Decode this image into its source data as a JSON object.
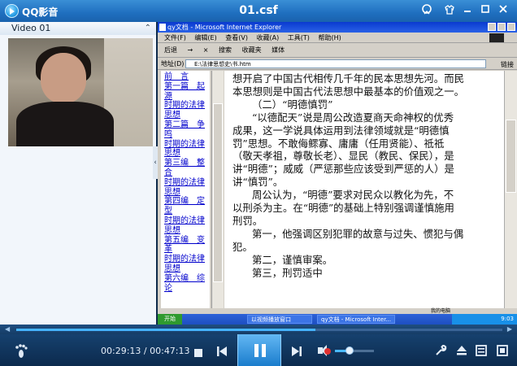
{
  "window": {
    "app_name": "QQ影音",
    "file_name": "01.csf"
  },
  "playlist": {
    "title": "Video 01",
    "collapse_glyph": "⌃"
  },
  "video_frame": {
    "ie_title": "qy文档 - Microsoft Internet Explorer",
    "ie_menu": [
      "文件(F)",
      "编辑(E)",
      "查看(V)",
      "收藏(A)",
      "工具(T)",
      "帮助(H)"
    ],
    "ie_toolbar": [
      "后退",
      "→",
      "×",
      "搜索",
      "收藏夹",
      "媒体"
    ],
    "address_label": "地址(D)",
    "address_value": "E:\\法律思想史\\书.htm",
    "go_label": "链接",
    "toc": [
      "前　言",
      "第一篇　起源",
      "时期的法律",
      "思想",
      "第二篇　争鸣",
      "时期的法律",
      "思想",
      "第三编　整合",
      "时期的法律",
      "思想",
      "第四编　定型",
      "时期的法律",
      "思想",
      "第五编　变革",
      "时期的法律",
      "思想",
      "第六编　综论"
    ],
    "doc_lines": [
      "想开启了中国古代相传几千年的民本思想先河。而民",
      "本思想则是中国古代法思想中最基本的价值观之一。",
      "（二）“明德慎罚”",
      "“以德配天”说是周公改造夏商天命神权的优秀",
      "成果，这一学说具体运用到法律领域就是“明德慎",
      "罚”思想。不敢侮鳏寡、庸庸（任用贤能）、祗祗",
      "（敬天孝祖，尊敬长老）、显民（教民、保民），是",
      "讲“明德”；威威（严惩那些应该受到严惩的人）是",
      "讲“慎罚”。",
      "周公认为，“明德”要求对民众以教化为先，不",
      "以刑杀为主。在“明德”的基础上特别强调谨慎施用",
      "刑罚。",
      "第一，他强调区别犯罪的故意与过失、惯犯与偶",
      "犯。",
      "第二，谨慎审案。",
      "第三，刑罚适中"
    ],
    "status_zone": "我的电脑",
    "taskbar": {
      "start": "开始",
      "tasks": [
        "以视频播放窗口",
        "qy文档 - Microsoft Inter..."
      ],
      "clock": "9:03"
    }
  },
  "player": {
    "progress_fraction": 0.616,
    "time_current": "00:29:13",
    "time_total": "00:47:13",
    "time_separator": " / ",
    "volume_fraction": 0.38,
    "icons": {
      "logo": "qq-player-logo-icon",
      "skin": "skin-icon",
      "minimize": "minimize-icon",
      "maximize": "maximize-icon",
      "close": "close-icon",
      "stop": "stop-icon",
      "prev": "previous-icon",
      "pause": "pause-icon",
      "next": "next-icon",
      "mute": "mute-icon",
      "toolbox": "wrench-icon",
      "eject": "eject-icon",
      "playlist": "playlist-icon",
      "fullscreen": "fullscreen-icon",
      "menu": "menu-icon"
    },
    "colors": {
      "accent": "#46b4ff",
      "titlebar": "#1f6fbf",
      "controlbar": "#0c2a4d"
    }
  }
}
